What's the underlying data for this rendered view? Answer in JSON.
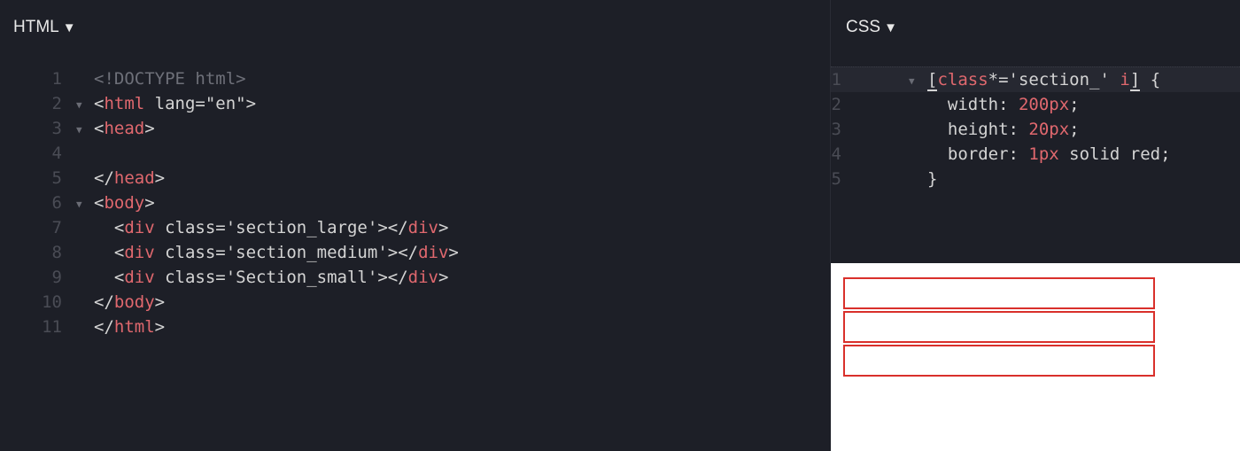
{
  "html_pane": {
    "title": "HTML",
    "title_caret": "▼",
    "lines": [
      {
        "num": "1",
        "fold": false,
        "parts": [
          {
            "t": "<!DOCTYPE html>",
            "c": "comment"
          }
        ]
      },
      {
        "num": "2",
        "fold": true,
        "parts": [
          {
            "t": "<",
            "c": ""
          },
          {
            "t": "html",
            "c": "tag"
          },
          {
            "t": " lang=\"en\">",
            "c": ""
          }
        ]
      },
      {
        "num": "3",
        "fold": true,
        "parts": [
          {
            "t": "<",
            "c": ""
          },
          {
            "t": "head",
            "c": "tag"
          },
          {
            "t": ">",
            "c": ""
          }
        ]
      },
      {
        "num": "4",
        "fold": false,
        "parts": []
      },
      {
        "num": "5",
        "fold": false,
        "parts": [
          {
            "t": "</",
            "c": ""
          },
          {
            "t": "head",
            "c": "tag"
          },
          {
            "t": ">",
            "c": ""
          }
        ]
      },
      {
        "num": "6",
        "fold": true,
        "parts": [
          {
            "t": "<",
            "c": ""
          },
          {
            "t": "body",
            "c": "tag"
          },
          {
            "t": ">",
            "c": ""
          }
        ]
      },
      {
        "num": "7",
        "fold": false,
        "parts": [
          {
            "t": "  <",
            "c": ""
          },
          {
            "t": "div",
            "c": "tag"
          },
          {
            "t": " class='section_large'></",
            "c": ""
          },
          {
            "t": "div",
            "c": "tag"
          },
          {
            "t": ">",
            "c": ""
          }
        ]
      },
      {
        "num": "8",
        "fold": false,
        "parts": [
          {
            "t": "  <",
            "c": ""
          },
          {
            "t": "div",
            "c": "tag"
          },
          {
            "t": " class='section_medium'></",
            "c": ""
          },
          {
            "t": "div",
            "c": "tag"
          },
          {
            "t": ">",
            "c": ""
          }
        ]
      },
      {
        "num": "9",
        "fold": false,
        "parts": [
          {
            "t": "  <",
            "c": ""
          },
          {
            "t": "div",
            "c": "tag"
          },
          {
            "t": " class='Section_small'></",
            "c": ""
          },
          {
            "t": "div",
            "c": "tag"
          },
          {
            "t": ">",
            "c": ""
          }
        ]
      },
      {
        "num": "10",
        "fold": false,
        "parts": [
          {
            "t": "</",
            "c": ""
          },
          {
            "t": "body",
            "c": "tag"
          },
          {
            "t": ">",
            "c": ""
          }
        ]
      },
      {
        "num": "11",
        "fold": false,
        "parts": [
          {
            "t": "</",
            "c": ""
          },
          {
            "t": "html",
            "c": "tag"
          },
          {
            "t": ">",
            "c": ""
          }
        ]
      }
    ]
  },
  "css_pane": {
    "title": "CSS",
    "title_caret": "▼",
    "lines": [
      {
        "num": "1",
        "fold": true,
        "active": true,
        "parts": [
          {
            "t": "[",
            "c": "cursor-mark"
          },
          {
            "t": "class",
            "c": "tag"
          },
          {
            "t": "*='section_' ",
            "c": ""
          },
          {
            "t": "i",
            "c": "tag"
          },
          {
            "t": "]",
            "c": "cursor-mark"
          },
          {
            "t": " {",
            "c": ""
          }
        ]
      },
      {
        "num": "2",
        "fold": false,
        "parts": [
          {
            "t": "  width: ",
            "c": ""
          },
          {
            "t": "200px",
            "c": "num"
          },
          {
            "t": ";",
            "c": ""
          }
        ]
      },
      {
        "num": "3",
        "fold": false,
        "parts": [
          {
            "t": "  height: ",
            "c": ""
          },
          {
            "t": "20px",
            "c": "num"
          },
          {
            "t": ";",
            "c": ""
          }
        ]
      },
      {
        "num": "4",
        "fold": false,
        "parts": [
          {
            "t": "  border: ",
            "c": ""
          },
          {
            "t": "1px",
            "c": "num"
          },
          {
            "t": " solid red;",
            "c": ""
          }
        ]
      },
      {
        "num": "5",
        "fold": false,
        "parts": [
          {
            "t": "}",
            "c": ""
          }
        ]
      }
    ]
  },
  "preview": {
    "boxes": [
      {
        "name": "section_large"
      },
      {
        "name": "section_medium"
      },
      {
        "name": "Section_small"
      }
    ],
    "border_color": "#d9302b"
  },
  "colors": {
    "editor_bg": "#1d1f27",
    "tag": "#e0686e",
    "text": "#d4d4d4",
    "line_number": "#4a4c55"
  }
}
